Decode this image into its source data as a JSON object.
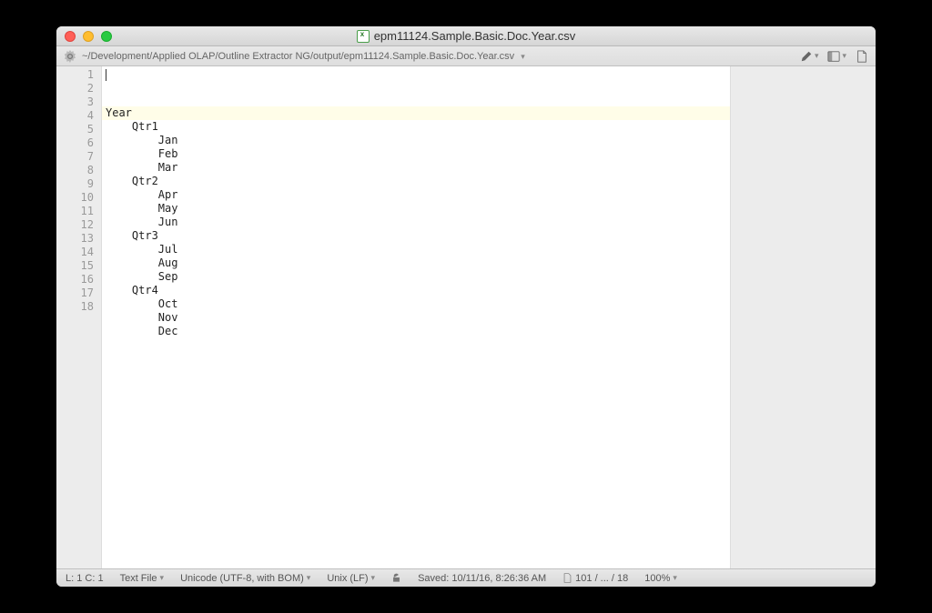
{
  "window": {
    "title": "epm11124.Sample.Basic.Doc.Year.csv"
  },
  "pathbar": {
    "path": "~/Development/Applied OLAP/Outline Extractor NG/output/epm11124.Sample.Basic.Doc.Year.csv"
  },
  "lines": [
    {
      "n": "1",
      "text": "Year",
      "indent": 0,
      "current": true
    },
    {
      "n": "2",
      "text": "Qtr1",
      "indent": 1
    },
    {
      "n": "3",
      "text": "Jan",
      "indent": 2
    },
    {
      "n": "4",
      "text": "Feb",
      "indent": 2
    },
    {
      "n": "5",
      "text": "Mar",
      "indent": 2
    },
    {
      "n": "6",
      "text": "Qtr2",
      "indent": 1
    },
    {
      "n": "7",
      "text": "Apr",
      "indent": 2
    },
    {
      "n": "8",
      "text": "May",
      "indent": 2
    },
    {
      "n": "9",
      "text": "Jun",
      "indent": 2
    },
    {
      "n": "10",
      "text": "Qtr3",
      "indent": 1
    },
    {
      "n": "11",
      "text": "Jul",
      "indent": 2
    },
    {
      "n": "12",
      "text": "Aug",
      "indent": 2
    },
    {
      "n": "13",
      "text": "Sep",
      "indent": 2
    },
    {
      "n": "14",
      "text": "Qtr4",
      "indent": 1
    },
    {
      "n": "15",
      "text": "Oct",
      "indent": 2
    },
    {
      "n": "16",
      "text": "Nov",
      "indent": 2
    },
    {
      "n": "17",
      "text": "Dec",
      "indent": 2
    },
    {
      "n": "18",
      "text": "",
      "indent": 0
    }
  ],
  "status": {
    "cursor": "L: 1 C: 1",
    "filetype": "Text File",
    "encoding": "Unicode (UTF-8, with BOM)",
    "lineending": "Unix (LF)",
    "saved": "Saved: 10/11/16, 8:26:36 AM",
    "stats": "101 / ... / 18",
    "zoom": "100%"
  }
}
